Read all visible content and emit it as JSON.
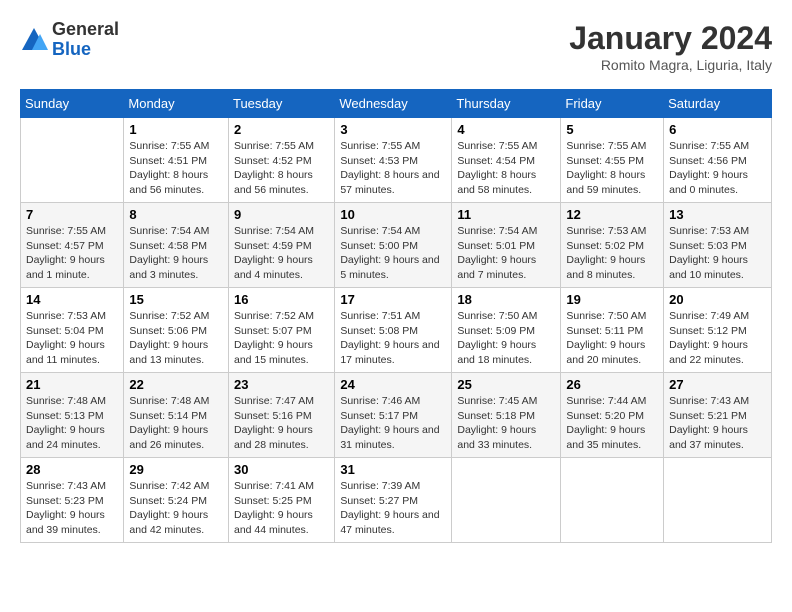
{
  "header": {
    "logo": {
      "general": "General",
      "blue": "Blue"
    },
    "title": "January 2024",
    "subtitle": "Romito Magra, Liguria, Italy"
  },
  "weekdays": [
    "Sunday",
    "Monday",
    "Tuesday",
    "Wednesday",
    "Thursday",
    "Friday",
    "Saturday"
  ],
  "weeks": [
    [
      {
        "day": null
      },
      {
        "day": 1,
        "sunrise": "7:55 AM",
        "sunset": "4:51 PM",
        "daylight": "8 hours and 56 minutes."
      },
      {
        "day": 2,
        "sunrise": "7:55 AM",
        "sunset": "4:52 PM",
        "daylight": "8 hours and 56 minutes."
      },
      {
        "day": 3,
        "sunrise": "7:55 AM",
        "sunset": "4:53 PM",
        "daylight": "8 hours and 57 minutes."
      },
      {
        "day": 4,
        "sunrise": "7:55 AM",
        "sunset": "4:54 PM",
        "daylight": "8 hours and 58 minutes."
      },
      {
        "day": 5,
        "sunrise": "7:55 AM",
        "sunset": "4:55 PM",
        "daylight": "8 hours and 59 minutes."
      },
      {
        "day": 6,
        "sunrise": "7:55 AM",
        "sunset": "4:56 PM",
        "daylight": "9 hours and 0 minutes."
      }
    ],
    [
      {
        "day": 7,
        "sunrise": "7:55 AM",
        "sunset": "4:57 PM",
        "daylight": "9 hours and 1 minute."
      },
      {
        "day": 8,
        "sunrise": "7:54 AM",
        "sunset": "4:58 PM",
        "daylight": "9 hours and 3 minutes."
      },
      {
        "day": 9,
        "sunrise": "7:54 AM",
        "sunset": "4:59 PM",
        "daylight": "9 hours and 4 minutes."
      },
      {
        "day": 10,
        "sunrise": "7:54 AM",
        "sunset": "5:00 PM",
        "daylight": "9 hours and 5 minutes."
      },
      {
        "day": 11,
        "sunrise": "7:54 AM",
        "sunset": "5:01 PM",
        "daylight": "9 hours and 7 minutes."
      },
      {
        "day": 12,
        "sunrise": "7:53 AM",
        "sunset": "5:02 PM",
        "daylight": "9 hours and 8 minutes."
      },
      {
        "day": 13,
        "sunrise": "7:53 AM",
        "sunset": "5:03 PM",
        "daylight": "9 hours and 10 minutes."
      }
    ],
    [
      {
        "day": 14,
        "sunrise": "7:53 AM",
        "sunset": "5:04 PM",
        "daylight": "9 hours and 11 minutes."
      },
      {
        "day": 15,
        "sunrise": "7:52 AM",
        "sunset": "5:06 PM",
        "daylight": "9 hours and 13 minutes."
      },
      {
        "day": 16,
        "sunrise": "7:52 AM",
        "sunset": "5:07 PM",
        "daylight": "9 hours and 15 minutes."
      },
      {
        "day": 17,
        "sunrise": "7:51 AM",
        "sunset": "5:08 PM",
        "daylight": "9 hours and 17 minutes."
      },
      {
        "day": 18,
        "sunrise": "7:50 AM",
        "sunset": "5:09 PM",
        "daylight": "9 hours and 18 minutes."
      },
      {
        "day": 19,
        "sunrise": "7:50 AM",
        "sunset": "5:11 PM",
        "daylight": "9 hours and 20 minutes."
      },
      {
        "day": 20,
        "sunrise": "7:49 AM",
        "sunset": "5:12 PM",
        "daylight": "9 hours and 22 minutes."
      }
    ],
    [
      {
        "day": 21,
        "sunrise": "7:48 AM",
        "sunset": "5:13 PM",
        "daylight": "9 hours and 24 minutes."
      },
      {
        "day": 22,
        "sunrise": "7:48 AM",
        "sunset": "5:14 PM",
        "daylight": "9 hours and 26 minutes."
      },
      {
        "day": 23,
        "sunrise": "7:47 AM",
        "sunset": "5:16 PM",
        "daylight": "9 hours and 28 minutes."
      },
      {
        "day": 24,
        "sunrise": "7:46 AM",
        "sunset": "5:17 PM",
        "daylight": "9 hours and 31 minutes."
      },
      {
        "day": 25,
        "sunrise": "7:45 AM",
        "sunset": "5:18 PM",
        "daylight": "9 hours and 33 minutes."
      },
      {
        "day": 26,
        "sunrise": "7:44 AM",
        "sunset": "5:20 PM",
        "daylight": "9 hours and 35 minutes."
      },
      {
        "day": 27,
        "sunrise": "7:43 AM",
        "sunset": "5:21 PM",
        "daylight": "9 hours and 37 minutes."
      }
    ],
    [
      {
        "day": 28,
        "sunrise": "7:43 AM",
        "sunset": "5:23 PM",
        "daylight": "9 hours and 39 minutes."
      },
      {
        "day": 29,
        "sunrise": "7:42 AM",
        "sunset": "5:24 PM",
        "daylight": "9 hours and 42 minutes."
      },
      {
        "day": 30,
        "sunrise": "7:41 AM",
        "sunset": "5:25 PM",
        "daylight": "9 hours and 44 minutes."
      },
      {
        "day": 31,
        "sunrise": "7:39 AM",
        "sunset": "5:27 PM",
        "daylight": "9 hours and 47 minutes."
      },
      {
        "day": null
      },
      {
        "day": null
      },
      {
        "day": null
      }
    ]
  ],
  "labels": {
    "sunrise": "Sunrise:",
    "sunset": "Sunset:",
    "daylight": "Daylight:"
  }
}
